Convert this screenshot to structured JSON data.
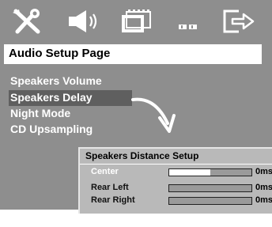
{
  "top_icons": [
    {
      "name": "general-setup-icon"
    },
    {
      "name": "audio-setup-icon"
    },
    {
      "name": "video-setup-icon"
    },
    {
      "name": "preferences-icon"
    },
    {
      "name": "exit-icon"
    }
  ],
  "header": {
    "title": "Audio Setup Page"
  },
  "menu": {
    "items": [
      {
        "label": "Speakers Volume"
      },
      {
        "label": "Speakers Delay"
      },
      {
        "label": "Night Mode"
      },
      {
        "label": "CD Upsampling"
      }
    ],
    "selected_label": "Speakers Delay"
  },
  "submenu": {
    "title": "Speakers Distance Setup",
    "rows": [
      {
        "label": "Center",
        "value": "0ms",
        "level": 0.5
      },
      {
        "label": "Rear Left",
        "value": "0ms",
        "level": 0
      },
      {
        "label": "Rear Right",
        "value": "0ms",
        "level": 0
      }
    ],
    "selected_row": "Center"
  },
  "colors": {
    "panel": "#8e8e8e",
    "highlight": "#5f5f5f",
    "submenu_bg": "#b9b9b9"
  }
}
